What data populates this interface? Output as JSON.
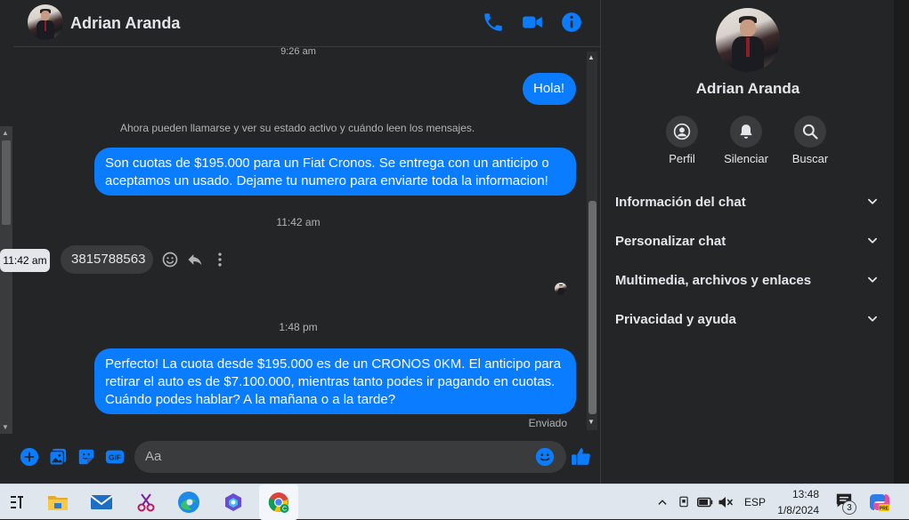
{
  "header": {
    "contact_name": "Adrian Aranda"
  },
  "messages": {
    "ts_top": "9:26 am",
    "hola": "Hola!",
    "system_notice": "Ahora pueden llamarse y ver su estado activo y cuándo leen los mensajes.",
    "msg_cuotas": "Son cuotas de $195.000 para un Fiat Cronos. Se entrega con un anticipo o aceptamos un usado. Dejame tu numero para enviarte toda la informacion!",
    "ts_1142": "11:42 am",
    "incoming_number": "3815788563",
    "tooltip_time": "11:42 am",
    "ts_148": "1:48 pm",
    "msg_perfecto": "Perfecto! La cuota desde $195.000 es de un CRONOS 0KM. El anticipo para retirar el auto es de $7.100.000, mientras tanto podes ir pagando en cuotas. Cuándo podes hablar? A la mañana o a la tarde?",
    "status": "Enviado"
  },
  "composer": {
    "placeholder": "Aa"
  },
  "side": {
    "name": "Adrian Aranda",
    "actions": [
      "Perfil",
      "Silenciar",
      "Buscar"
    ],
    "sections": [
      "Información del chat",
      "Personalizar chat",
      "Multimedia, archivos y enlaces",
      "Privacidad y ayuda"
    ]
  },
  "taskbar": {
    "language": "ESP",
    "time": "13:48",
    "date": "1/8/2024",
    "notification_count": "3"
  },
  "colors": {
    "accent": "#0a7cff",
    "background": "#242526",
    "bubble_in": "#3a3b3c"
  },
  "icons": [
    "phone-icon",
    "video-icon",
    "info-icon",
    "plus-icon",
    "image-icon",
    "sticker-icon",
    "gif-icon",
    "emoji-icon",
    "like-icon",
    "profile-icon",
    "bell-icon",
    "search-icon",
    "chevron-down-icon"
  ]
}
